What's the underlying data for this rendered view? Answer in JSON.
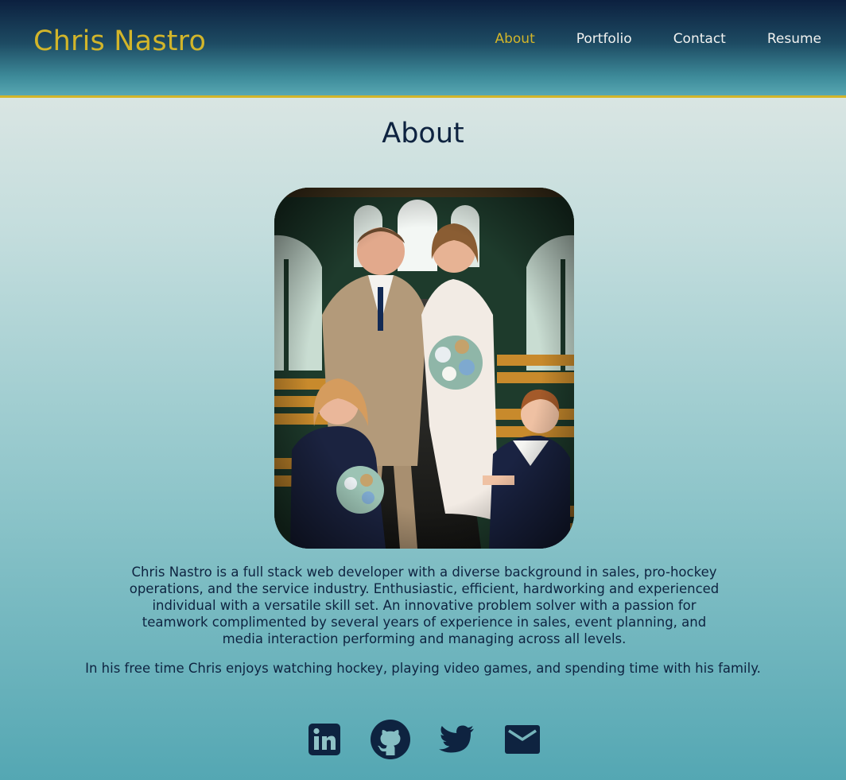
{
  "header": {
    "brand": "Chris Nastro",
    "nav": [
      {
        "label": "About",
        "active": true
      },
      {
        "label": "Portfolio",
        "active": false
      },
      {
        "label": "Contact",
        "active": false
      },
      {
        "label": "Resume",
        "active": false
      }
    ]
  },
  "main": {
    "title": "About",
    "bio": "Chris Nastro is a full stack web developer with a diverse background in sales, pro-hockey operations, and the service industry. Enthusiastic, efficient, hardworking and experienced individual with a versatile skill set. An innovative problem solver with a passion for teamwork complimented by several years of experience in sales, event planning, and media interaction performing and managing across all levels.",
    "free_time": "In his free time Chris enjoys watching hockey, playing video games, and spending time with his family."
  },
  "socials": [
    {
      "icon": "linkedin-icon"
    },
    {
      "icon": "github-icon"
    },
    {
      "icon": "twitter-icon"
    },
    {
      "icon": "email-icon"
    }
  ],
  "colors": {
    "accent": "#d2b52a",
    "navy": "#0e2340",
    "nav_text": "#f1f2f0"
  }
}
